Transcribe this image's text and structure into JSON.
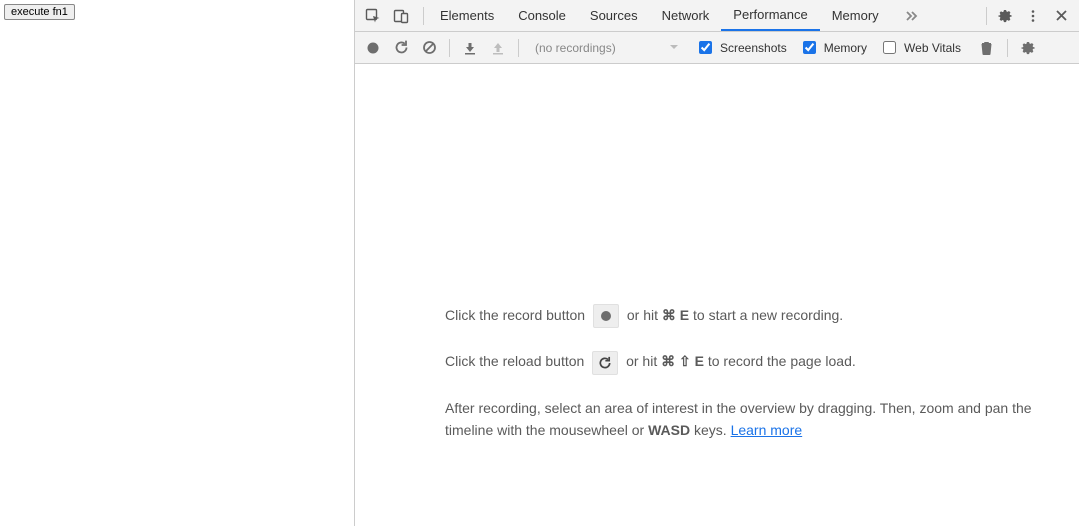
{
  "page": {
    "button_label": "execute fn1"
  },
  "tabs": {
    "items": [
      "Elements",
      "Console",
      "Sources",
      "Network",
      "Performance",
      "Memory"
    ],
    "active_index": 4
  },
  "toolbar": {
    "dropdown_label": "(no recordings)",
    "checkboxes": {
      "screenshots": {
        "label": "Screenshots",
        "checked": true
      },
      "memory": {
        "label": "Memory",
        "checked": true
      },
      "web_vitals": {
        "label": "Web Vitals",
        "checked": false
      }
    }
  },
  "help": {
    "line1_a": "Click the record button ",
    "line1_b": " or hit ",
    "line1_shortcut": "⌘ E",
    "line1_c": " to start a new recording.",
    "line2_a": "Click the reload button ",
    "line2_b": " or hit ",
    "line2_shortcut": "⌘ ⇧ E",
    "line2_c": " to record the page load.",
    "line3_a": "After recording, select an area of interest in the overview by dragging. Then, zoom and pan the timeline with the mousewheel or ",
    "line3_bold": "WASD",
    "line3_b": " keys. ",
    "learn_more": "Learn more"
  }
}
